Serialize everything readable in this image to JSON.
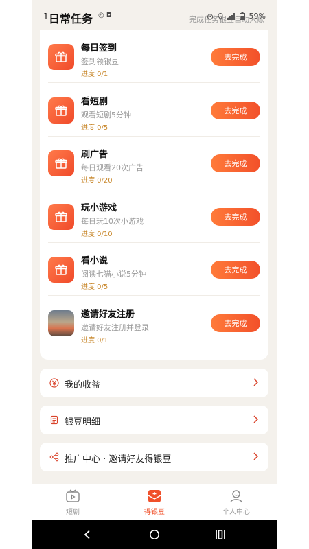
{
  "status_bar": {
    "time": "1",
    "left_icons": "◎ ◘",
    "right_text": "59%"
  },
  "header": {
    "title": "日常任务",
    "subtitle": "完成任务银豆自动入账"
  },
  "tasks": [
    {
      "title": "每日签到",
      "desc": "签到领银豆",
      "progress": "进度 0/1",
      "button": "去完成",
      "icon": "gift-icon"
    },
    {
      "title": "看短剧",
      "desc": "观看短剧5分钟",
      "progress": "进度 0/5",
      "button": "去完成",
      "icon": "gift-icon"
    },
    {
      "title": "刷广告",
      "desc": "每日观看20次广告",
      "progress": "进度 0/20",
      "button": "去完成",
      "icon": "gift-icon"
    },
    {
      "title": "玩小游戏",
      "desc": "每日玩10次小游戏",
      "progress": "进度 0/10",
      "button": "去完成",
      "icon": "gift-icon"
    },
    {
      "title": "看小说",
      "desc": "阅读七猫小说5分钟",
      "progress": "进度 0/5",
      "button": "去完成",
      "icon": "gift-icon"
    },
    {
      "title": "邀请好友注册",
      "desc": "邀请好友注册并登录",
      "progress": "进度 0/1",
      "button": "去完成",
      "icon": "photo-thumbnail"
    }
  ],
  "menu": [
    {
      "label": "我的收益",
      "icon": "yen-icon"
    },
    {
      "label": "银豆明细",
      "icon": "list-icon"
    },
    {
      "label": "推广中心 · 邀请好友得银豆",
      "icon": "share-icon"
    }
  ],
  "bottom_nav": [
    {
      "label": "短剧",
      "icon": "tv-icon",
      "active": false
    },
    {
      "label": "得银豆",
      "icon": "envelope-icon",
      "active": true
    },
    {
      "label": "个人中心",
      "icon": "person-icon",
      "active": false
    }
  ],
  "colors": {
    "accent": "#f0502a",
    "progress": "#c9892e",
    "background": "#f4f1ec"
  }
}
